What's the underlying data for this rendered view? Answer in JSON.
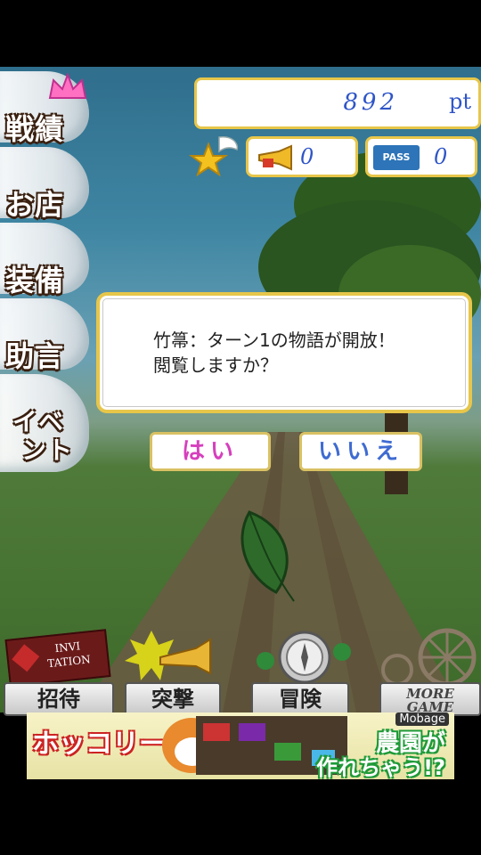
{
  "points": {
    "value": "892",
    "unit": "pt"
  },
  "items": {
    "trumpet_count": "0",
    "pass_count": "0",
    "pass_label": "PASS"
  },
  "menu": [
    "戦績",
    "お店",
    "装備",
    "助言",
    "イベ",
    "ント"
  ],
  "dialog": {
    "line1": "竹箒：ターン1の物語が開放！",
    "line2": "閲覧しますか？",
    "yes": "はい",
    "no": "いいえ"
  },
  "bottom_nav": {
    "invitation_card": "INVI TATION",
    "invite": "招待",
    "attack": "突撃",
    "adventure": "冒険",
    "more_line1": "MORE",
    "more_line2": "GAME"
  },
  "ad": {
    "badge": "Mobage",
    "logo": "ホッコリーナ",
    "copy1": "農園が",
    "copy2": "作れちゃう!?"
  }
}
